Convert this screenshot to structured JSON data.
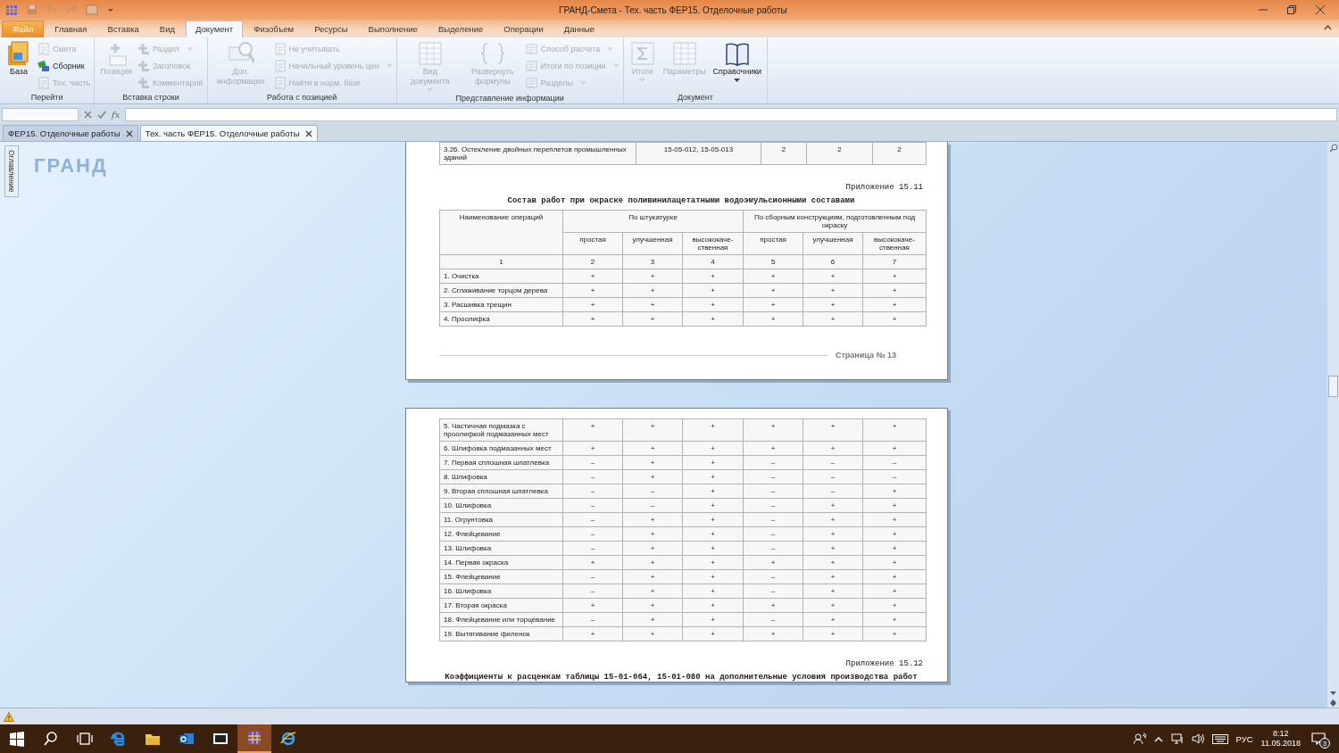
{
  "window": {
    "title": "ГРАНД-Смета - Тех. часть ФЕР15. Отделочные работы"
  },
  "menu_tabs": [
    {
      "label": "Файл",
      "kind": "file",
      "selected": false
    },
    {
      "label": "Главная",
      "kind": "tab",
      "selected": false
    },
    {
      "label": "Вставка",
      "kind": "tab",
      "selected": false
    },
    {
      "label": "Вид",
      "kind": "tab",
      "selected": false
    },
    {
      "label": "Документ",
      "kind": "tab",
      "selected": true
    },
    {
      "label": "Физобъем",
      "kind": "tab",
      "selected": false
    },
    {
      "label": "Ресурсы",
      "kind": "tab",
      "selected": false
    },
    {
      "label": "Выполнение",
      "kind": "tab",
      "selected": false
    },
    {
      "label": "Выделение",
      "kind": "tab",
      "selected": false
    },
    {
      "label": "Операции",
      "kind": "tab",
      "selected": false
    },
    {
      "label": "Данные",
      "kind": "tab",
      "selected": false
    }
  ],
  "ribbon_groups": [
    {
      "title": "Перейти",
      "items": [
        {
          "label": "База",
          "kind": "large",
          "disabled": false,
          "dropdown": false
        },
        {
          "label": "Смета",
          "kind": "small",
          "disabled": true,
          "dropdown": false
        },
        {
          "label": "Сборник",
          "kind": "small",
          "disabled": false,
          "dropdown": false
        },
        {
          "label": "Тех. часть",
          "kind": "small",
          "disabled": true,
          "dropdown": false
        }
      ]
    },
    {
      "title": "Вставка строки",
      "items": [
        {
          "label": "Позиция",
          "kind": "large",
          "disabled": true,
          "dropdown": false
        },
        {
          "label": "Раздел",
          "kind": "small",
          "disabled": true,
          "dropdown": true
        },
        {
          "label": "Заголовок",
          "kind": "small",
          "disabled": true,
          "dropdown": false
        },
        {
          "label": "Комментарий",
          "kind": "small",
          "disabled": true,
          "dropdown": false
        }
      ]
    },
    {
      "title": "Работа с позицией",
      "items": [
        {
          "label": "Доп. информация",
          "kind": "large",
          "disabled": true,
          "dropdown": false
        },
        {
          "label": "Не учитывать",
          "kind": "small",
          "disabled": true,
          "dropdown": false
        },
        {
          "label": "Начальный уровень цен",
          "kind": "small",
          "disabled": true,
          "dropdown": true
        },
        {
          "label": "Найти в норм. базе",
          "kind": "small",
          "disabled": true,
          "dropdown": false
        }
      ]
    },
    {
      "title": "Представление информации",
      "items": [
        {
          "label": "Вид документа",
          "kind": "large",
          "disabled": true,
          "dropdown": true
        },
        {
          "label": "Развернуть формулы",
          "kind": "large",
          "disabled": true,
          "dropdown": false
        },
        {
          "label": "Способ расчета",
          "kind": "small",
          "disabled": true,
          "dropdown": true
        },
        {
          "label": "Итоги по позиции",
          "kind": "small",
          "disabled": true,
          "dropdown": true
        },
        {
          "label": "Разделы",
          "kind": "small",
          "disabled": true,
          "dropdown": true
        }
      ]
    },
    {
      "title": "Документ",
      "items": [
        {
          "label": "Итоги",
          "kind": "large",
          "disabled": true,
          "dropdown": true
        },
        {
          "label": "Параметры",
          "kind": "large",
          "disabled": true,
          "dropdown": false
        },
        {
          "label": "Справочники",
          "kind": "large",
          "disabled": false,
          "dropdown": true
        }
      ]
    }
  ],
  "formula_bar": {
    "function_symbol": "fx"
  },
  "doc_tabs": [
    {
      "label": "ФЕР15. Отделочные работы",
      "selected": false
    },
    {
      "label": "Тех. часть ФЕР15. Отделочные работы",
      "selected": true
    }
  ],
  "side_panel": {
    "label": "Оглавление"
  },
  "logo": "ГРАНД",
  "page_1": {
    "prev_row": [
      "3.26. Остекление двойных переплетов промышленных зданий",
      "15-05-012, 15-05-013",
      "2",
      "2",
      "2"
    ],
    "appendix": "Приложение 15.11",
    "title": "Состав работ при окраске поливинилацетатными водоэмульсионными составами",
    "table": {
      "name_header": "Наименование операций",
      "groups": [
        {
          "label": "По штукатурке",
          "subcolumns": [
            "простая",
            "улучшенная",
            "высококаче-ственная"
          ]
        },
        {
          "label": "По сборным конструкциям, подготовленным под окраску",
          "subcolumns": [
            "простая",
            "улучшенная",
            "высококаче-ственная"
          ]
        }
      ],
      "column_numbers": [
        "1",
        "2",
        "3",
        "4",
        "5",
        "6",
        "7"
      ],
      "rows": [
        [
          "1. Очистка",
          "+",
          "+",
          "+",
          "+",
          "+",
          "+"
        ],
        [
          "2. Сглаживание торцом дерева",
          "+",
          "+",
          "+",
          "+",
          "+",
          "+"
        ],
        [
          "3. Расшивка трещин",
          "+",
          "+",
          "+",
          "+",
          "+",
          "+"
        ],
        [
          "4. Проолифка",
          "+",
          "+",
          "+",
          "+",
          "+",
          "+"
        ]
      ]
    },
    "page_number": "Страница № 13"
  },
  "page_2": {
    "rows": [
      [
        "5. Частичная подмазка с проолифкой подмазанных мест",
        "+",
        "+",
        "+",
        "+",
        "+",
        "+"
      ],
      [
        "6. Шлифовка подмазанных мест",
        "+",
        "+",
        "+",
        "+",
        "+",
        "+"
      ],
      [
        "7. Первая сплошная шпатлевка",
        "–",
        "+",
        "+",
        "–",
        "–",
        "–"
      ],
      [
        "8. Шлифовка",
        "–",
        "+",
        "+",
        "–",
        "–",
        "–"
      ],
      [
        "9. Вторая сплошная шпатлевка",
        "–",
        "–",
        "+",
        "–",
        "–",
        "+"
      ],
      [
        "10. Шлифовка",
        "–",
        "–",
        "+",
        "–",
        "+",
        "+"
      ],
      [
        "11. Огрунтовка",
        "–",
        "+",
        "+",
        "–",
        "+",
        "+"
      ],
      [
        "12. Флейцевание",
        "–",
        "+",
        "+",
        "–",
        "+",
        "+"
      ],
      [
        "13. Шлифовка",
        "–",
        "+",
        "+",
        "–",
        "+",
        "+"
      ],
      [
        "14. Первая окраска",
        "+",
        "+",
        "+",
        "+",
        "+",
        "+"
      ],
      [
        "15. Флейцевание",
        "–",
        "+",
        "+",
        "–",
        "+",
        "+"
      ],
      [
        "16. Шлифовка",
        "–",
        "+",
        "+",
        "–",
        "+",
        "+"
      ],
      [
        "17. Вторая окраска",
        "+",
        "+",
        "+",
        "+",
        "+",
        "+"
      ],
      [
        "18. Флейцевание или торцевание",
        "–",
        "+",
        "+",
        "–",
        "+",
        "+"
      ],
      [
        "19. Вытягивание филенок",
        "+",
        "+",
        "+",
        "+",
        "+",
        "+"
      ]
    ],
    "appendix": "Приложение 15.12",
    "title": "Коэффициенты к расценкам таблицы 15-01-064, 15-01-080 на дополнительные условия производства работ"
  },
  "tray": {
    "language": "РУС",
    "time": "8:12",
    "date": "11.05.2018",
    "notifications": "3"
  }
}
